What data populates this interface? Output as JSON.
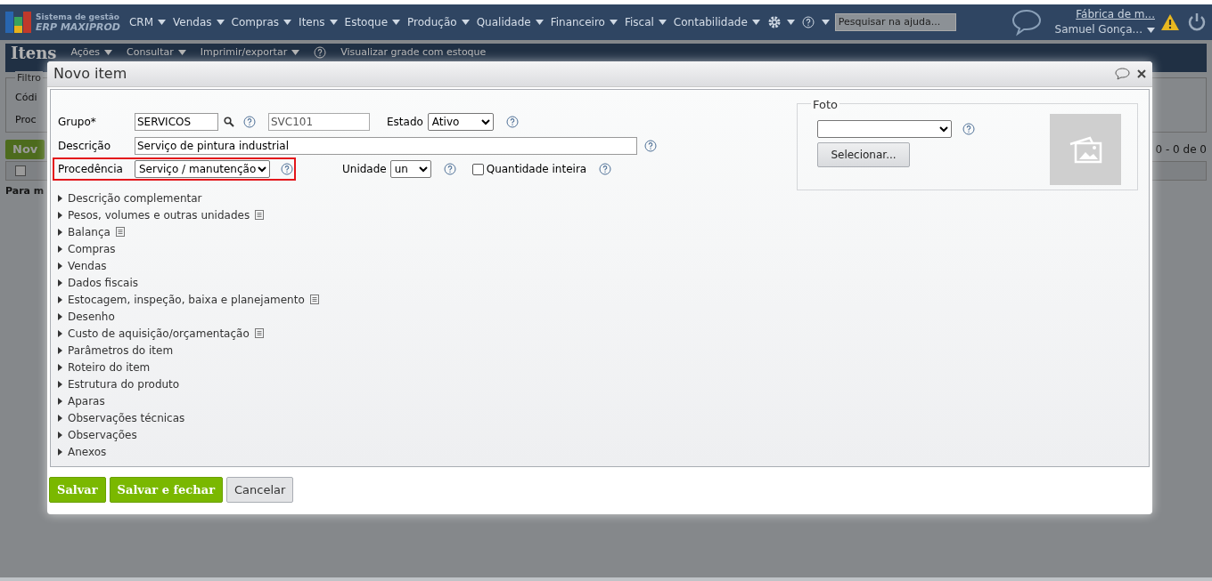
{
  "app": {
    "logo_line1": "Sistema de gestão",
    "logo_line2": "ERP MAXIPROD"
  },
  "menu": [
    "CRM",
    "Vendas",
    "Compras",
    "Itens",
    "Estoque",
    "Produção",
    "Qualidade",
    "Financeiro",
    "Fiscal",
    "Contabilidade"
  ],
  "help_search": {
    "placeholder": "Pesquisar na ajuda..."
  },
  "company": "Fábrica de m...",
  "user": "Samuel Gonça...",
  "page": {
    "title": "Itens",
    "toolbar": [
      "Ações",
      "Consultar",
      "Imprimir/exportar"
    ],
    "grid_link": "Visualizar grade com estoque",
    "filter_legend": "Filtro",
    "filter_labels": [
      "Códi",
      "Proc"
    ],
    "new_button": "Nov",
    "select_all_checked": false,
    "empty_text": "Para m",
    "pager": "0 - 0 de 0"
  },
  "dialog": {
    "title": "Novo item",
    "fields": {
      "group_label": "Grupo*",
      "group_value": "SERVICOS",
      "code_value": "SVC101",
      "state_label": "Estado",
      "state_value": "Ativo",
      "description_label": "Descrição",
      "description_value": "Serviço de pintura industrial",
      "origin_label": "Procedência",
      "origin_value": "Serviço / manutenção",
      "unit_label": "Unidade",
      "unit_value": "un",
      "integer_label": "Quantidade inteira",
      "integer_checked": false
    },
    "photo": {
      "legend": "Foto",
      "select_button": "Selecionar..."
    },
    "sections": [
      {
        "label": "Descrição complementar",
        "expanded": false,
        "note": false
      },
      {
        "label": "Pesos, volumes e outras unidades",
        "expanded": false,
        "note": true
      },
      {
        "label": "Balança",
        "expanded": false,
        "note": true
      },
      {
        "label": "Compras",
        "expanded": false,
        "note": false
      },
      {
        "label": "Vendas",
        "expanded": false,
        "note": false
      },
      {
        "label": "Dados fiscais",
        "expanded": false,
        "note": false
      },
      {
        "label": "Estocagem, inspeção, baixa e planejamento",
        "expanded": false,
        "note": true
      },
      {
        "label": "Desenho",
        "expanded": false,
        "note": false
      },
      {
        "label": "Custo de aquisição/orçamentação",
        "expanded": false,
        "note": true
      },
      {
        "label": "Parâmetros do item",
        "expanded": false,
        "note": false
      },
      {
        "label": "Roteiro do item",
        "expanded": false,
        "note": false
      },
      {
        "label": "Estrutura do produto",
        "expanded": false,
        "note": false
      },
      {
        "label": "Aparas",
        "expanded": false,
        "note": false
      },
      {
        "label": "Observações técnicas",
        "expanded": false,
        "note": false
      },
      {
        "label": "Observações",
        "expanded": false,
        "note": false
      },
      {
        "label": "Anexos",
        "expanded": false,
        "note": false
      }
    ],
    "buttons": [
      {
        "label": "Salvar",
        "kind": "primary"
      },
      {
        "label": "Salvar e fechar",
        "kind": "primary"
      },
      {
        "label": "Cancelar",
        "kind": "secondary"
      }
    ]
  }
}
